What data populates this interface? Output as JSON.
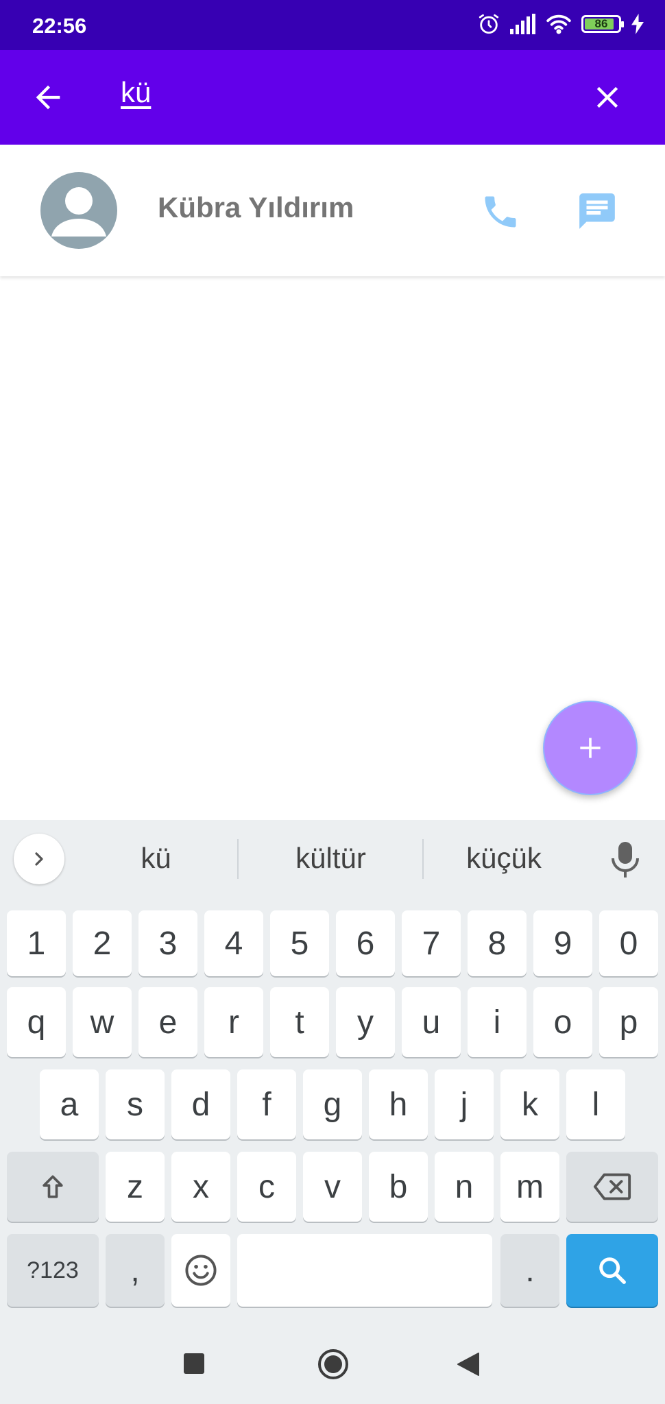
{
  "status_bar": {
    "time": "22:56",
    "battery": "86"
  },
  "search": {
    "query": "kü"
  },
  "results": [
    {
      "name": "Kübra Yıldırım"
    }
  ],
  "keyboard": {
    "suggestions": [
      "kü",
      "kültür",
      "küçük"
    ],
    "number_row": [
      "1",
      "2",
      "3",
      "4",
      "5",
      "6",
      "7",
      "8",
      "9",
      "0"
    ],
    "row1": [
      "q",
      "w",
      "e",
      "r",
      "t",
      "y",
      "u",
      "i",
      "o",
      "p"
    ],
    "row2": [
      "a",
      "s",
      "d",
      "f",
      "g",
      "h",
      "j",
      "k",
      "l"
    ],
    "row3": [
      "z",
      "x",
      "c",
      "v",
      "b",
      "n",
      "m"
    ],
    "symbols_key": "?123",
    "comma_key": ",",
    "period_key": "."
  },
  "colors": {
    "status_bar": "#3700b3",
    "app_bar": "#6200ea",
    "fab": "#b388ff",
    "action_icons": "#90caf9",
    "search_key": "#2fa3e6"
  },
  "icons": [
    "alarm-icon",
    "signal-icon",
    "wifi-icon",
    "battery-icon",
    "charging-icon",
    "back-arrow-icon",
    "close-icon",
    "person-icon",
    "phone-icon",
    "message-icon",
    "plus-icon",
    "chevron-right-icon",
    "mic-icon",
    "shift-icon",
    "backspace-icon",
    "emoji-icon",
    "search-icon"
  ]
}
